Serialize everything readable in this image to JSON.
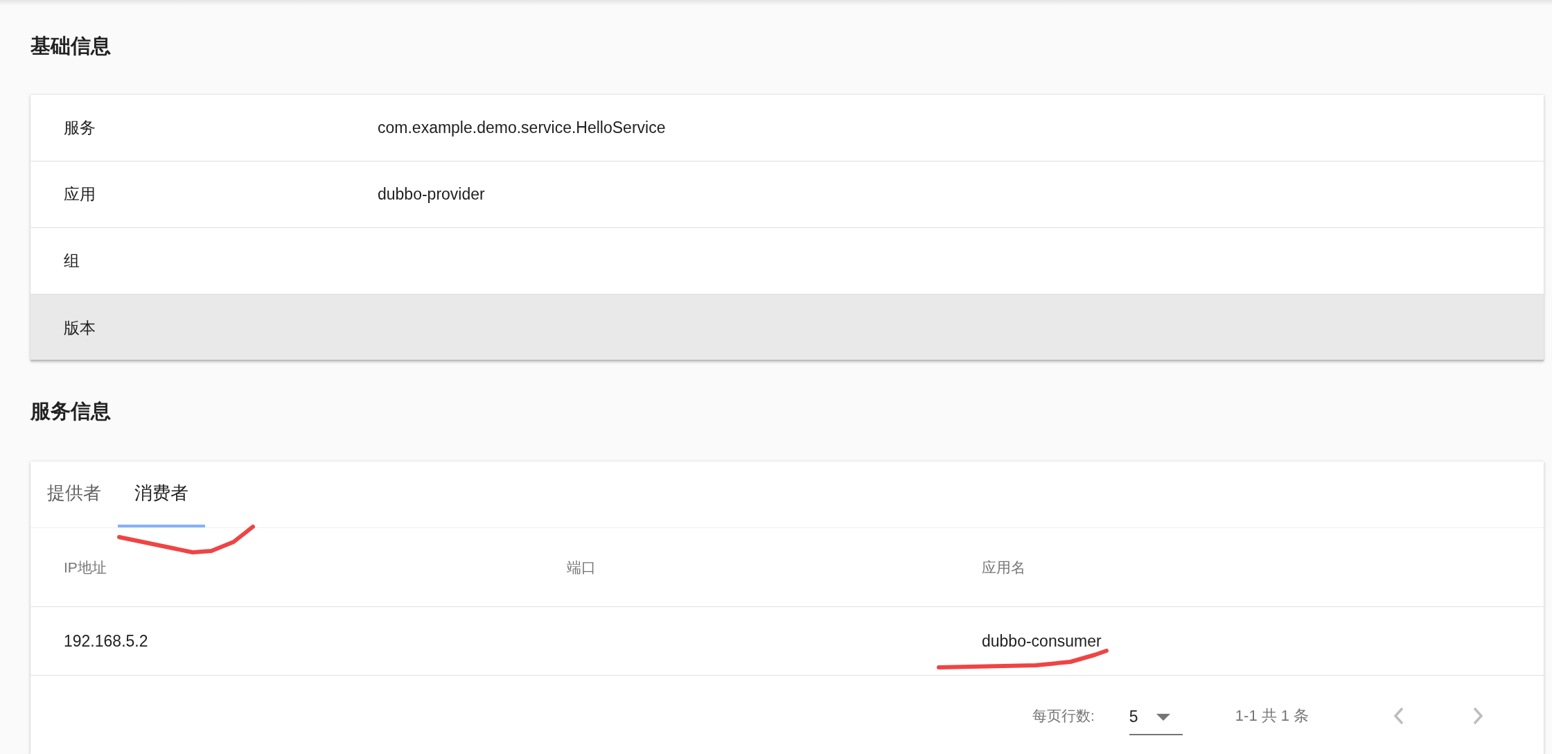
{
  "basic_info": {
    "title": "基础信息",
    "rows": [
      {
        "label": "服务",
        "value": "com.example.demo.service.HelloService",
        "highlighted": false
      },
      {
        "label": "应用",
        "value": "dubbo-provider",
        "highlighted": false
      },
      {
        "label": "组",
        "highlighted": false
      },
      {
        "label": "版本",
        "highlighted": true
      }
    ]
  },
  "service_info": {
    "title": "服务信息",
    "tabs": [
      {
        "label": "提供者",
        "selected": false
      },
      {
        "label": "消费者",
        "selected": true
      }
    ],
    "table": {
      "columns": [
        "IP地址",
        "端口",
        "应用名"
      ],
      "rows": [
        [
          "192.168.5.2",
          "",
          "dubbo-consumer"
        ]
      ]
    },
    "pagination": {
      "rows_per_page_label": "每页行数:",
      "rows_per_page": "5",
      "range": "1-1 共 1 条"
    }
  }
}
